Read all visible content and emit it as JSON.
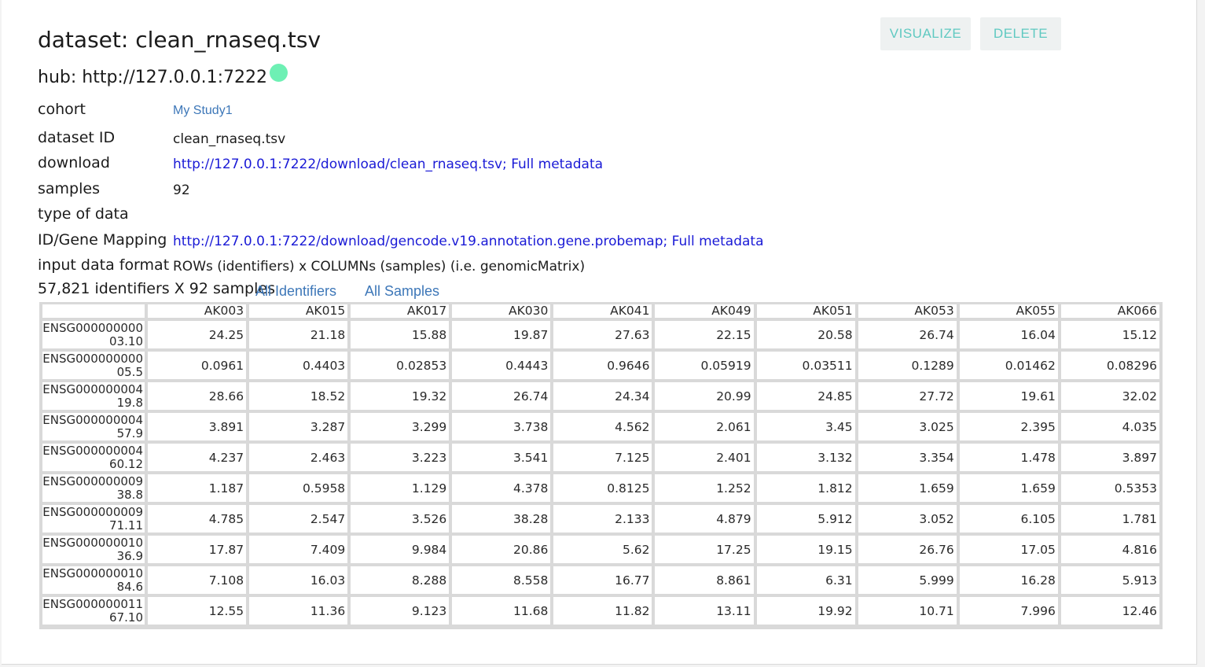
{
  "title": "dataset: clean_rnaseq.tsv",
  "hub": {
    "label": "hub: http://127.0.0.1:7222",
    "status_color": "#6ef0b4"
  },
  "actions": {
    "visualize": "VISUALIZE",
    "delete": "DELETE",
    "text_color": "#5fc9c1"
  },
  "meta": {
    "cohort_label": "cohort",
    "cohort_value": "My Study1",
    "dataset_id_label": "dataset ID",
    "dataset_id_value": "clean_rnaseq.tsv",
    "download_label": "download",
    "download_url": "http://127.0.0.1:7222/download/clean_rnaseq.tsv",
    "download_sep": "; ",
    "download_meta": "Full metadata",
    "samples_label": "samples",
    "samples_value": "92",
    "type_label": "type of data",
    "type_value": "",
    "mapping_label": "ID/Gene Mapping",
    "mapping_url": "http://127.0.0.1:7222/download/gencode.v19.annotation.gene.probemap",
    "mapping_sep": "; ",
    "mapping_meta": "Full metadata",
    "format_label": "input data format",
    "format_value": "ROWs (identifiers) x COLUMNs (samples) (i.e. genomicMatrix)"
  },
  "summary": {
    "text": "57,821 identifiers X 92 samples",
    "all_identifiers": "All Identifiers",
    "all_samples": "All Samples"
  },
  "table": {
    "columns": [
      "",
      "AK003",
      "AK015",
      "AK017",
      "AK030",
      "AK041",
      "AK049",
      "AK051",
      "AK053",
      "AK055",
      "AK066"
    ],
    "rows": [
      {
        "id": "ENSG00000000003.10",
        "values": [
          "24.25",
          "21.18",
          "15.88",
          "19.87",
          "27.63",
          "22.15",
          "20.58",
          "26.74",
          "16.04",
          "15.12"
        ]
      },
      {
        "id": "ENSG00000000005.5",
        "values": [
          "0.0961",
          "0.4403",
          "0.02853",
          "0.4443",
          "0.9646",
          "0.05919",
          "0.03511",
          "0.1289",
          "0.01462",
          "0.08296"
        ]
      },
      {
        "id": "ENSG00000000419.8",
        "values": [
          "28.66",
          "18.52",
          "19.32",
          "26.74",
          "24.34",
          "20.99",
          "24.85",
          "27.72",
          "19.61",
          "32.02"
        ]
      },
      {
        "id": "ENSG00000000457.9",
        "values": [
          "3.891",
          "3.287",
          "3.299",
          "3.738",
          "4.562",
          "2.061",
          "3.45",
          "3.025",
          "2.395",
          "4.035"
        ]
      },
      {
        "id": "ENSG00000000460.12",
        "values": [
          "4.237",
          "2.463",
          "3.223",
          "3.541",
          "7.125",
          "2.401",
          "3.132",
          "3.354",
          "1.478",
          "3.897"
        ]
      },
      {
        "id": "ENSG00000000938.8",
        "values": [
          "1.187",
          "0.5958",
          "1.129",
          "4.378",
          "0.8125",
          "1.252",
          "1.812",
          "1.659",
          "1.659",
          "0.5353"
        ]
      },
      {
        "id": "ENSG00000000971.11",
        "values": [
          "4.785",
          "2.547",
          "3.526",
          "38.28",
          "2.133",
          "4.879",
          "5.912",
          "3.052",
          "6.105",
          "1.781"
        ]
      },
      {
        "id": "ENSG00000001036.9",
        "values": [
          "17.87",
          "7.409",
          "9.984",
          "20.86",
          "5.62",
          "17.25",
          "19.15",
          "26.76",
          "17.05",
          "4.816"
        ]
      },
      {
        "id": "ENSG00000001084.6",
        "values": [
          "7.108",
          "16.03",
          "8.288",
          "8.558",
          "16.77",
          "8.861",
          "6.31",
          "5.999",
          "16.28",
          "5.913"
        ]
      },
      {
        "id": "ENSG00000001167.10",
        "values": [
          "12.55",
          "11.36",
          "9.123",
          "11.68",
          "11.82",
          "13.11",
          "19.92",
          "10.71",
          "7.996",
          "12.46"
        ]
      }
    ]
  }
}
